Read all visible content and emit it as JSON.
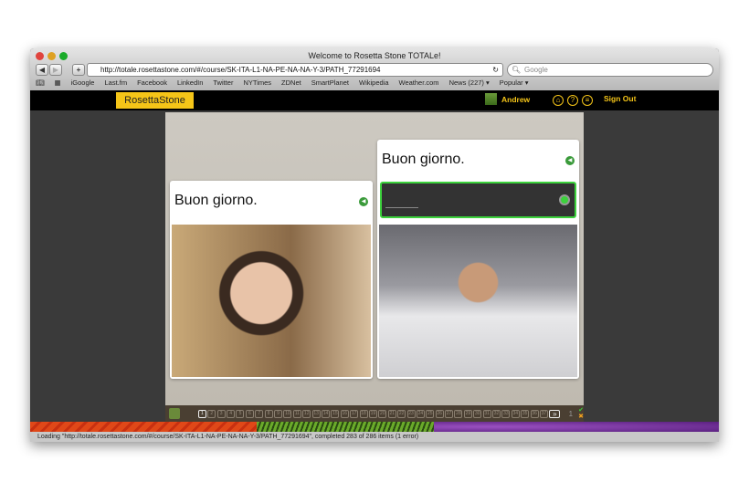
{
  "window": {
    "title": "Welcome to Rosetta Stone TOTALe!"
  },
  "toolbar": {
    "back": "◀",
    "forward": "▶",
    "add": "+",
    "url": "http://totale.rosettastone.com/#/course/SK-ITA-L1-NA-PE-NA-NA-Y-3/PATH_77291694",
    "reload": "↻",
    "search_placeholder": "Google"
  },
  "bookmarks": [
    "iGoogle",
    "Last.fm",
    "Facebook",
    "LinkedIn",
    "Twitter",
    "NYTimes",
    "ZDNet",
    "SmartPlanet",
    "Wikipedia",
    "Weather.com",
    "News (227) ▾",
    "Popular ▾"
  ],
  "app": {
    "logo": "RosettaStone",
    "user": "Andrew",
    "sign_out": "Sign Out",
    "home": "⌂",
    "help": "?",
    "menu": "≡"
  },
  "lesson": {
    "left_phrase": "Buon giorno.",
    "right_phrase": "Buon giorno.",
    "pages": [
      "1",
      "2",
      "3",
      "4",
      "5",
      "6",
      "7",
      "8",
      "9",
      "10",
      "11",
      "12",
      "13",
      "14",
      "15",
      "16",
      "17",
      "18",
      "19",
      "20",
      "21",
      "22",
      "23",
      "24",
      "25",
      "26",
      "27",
      "28",
      "29",
      "30",
      "31",
      "32",
      "33",
      "34",
      "35",
      "36",
      "37"
    ],
    "current_page": 1,
    "next": "»",
    "score": "1"
  },
  "status": "Loading \"http://totale.rosettastone.com/#/course/SK-ITA-L1-NA-PE-NA-NA-Y-3/PATH_77291694\", completed 283 of 286 items (1 error)"
}
